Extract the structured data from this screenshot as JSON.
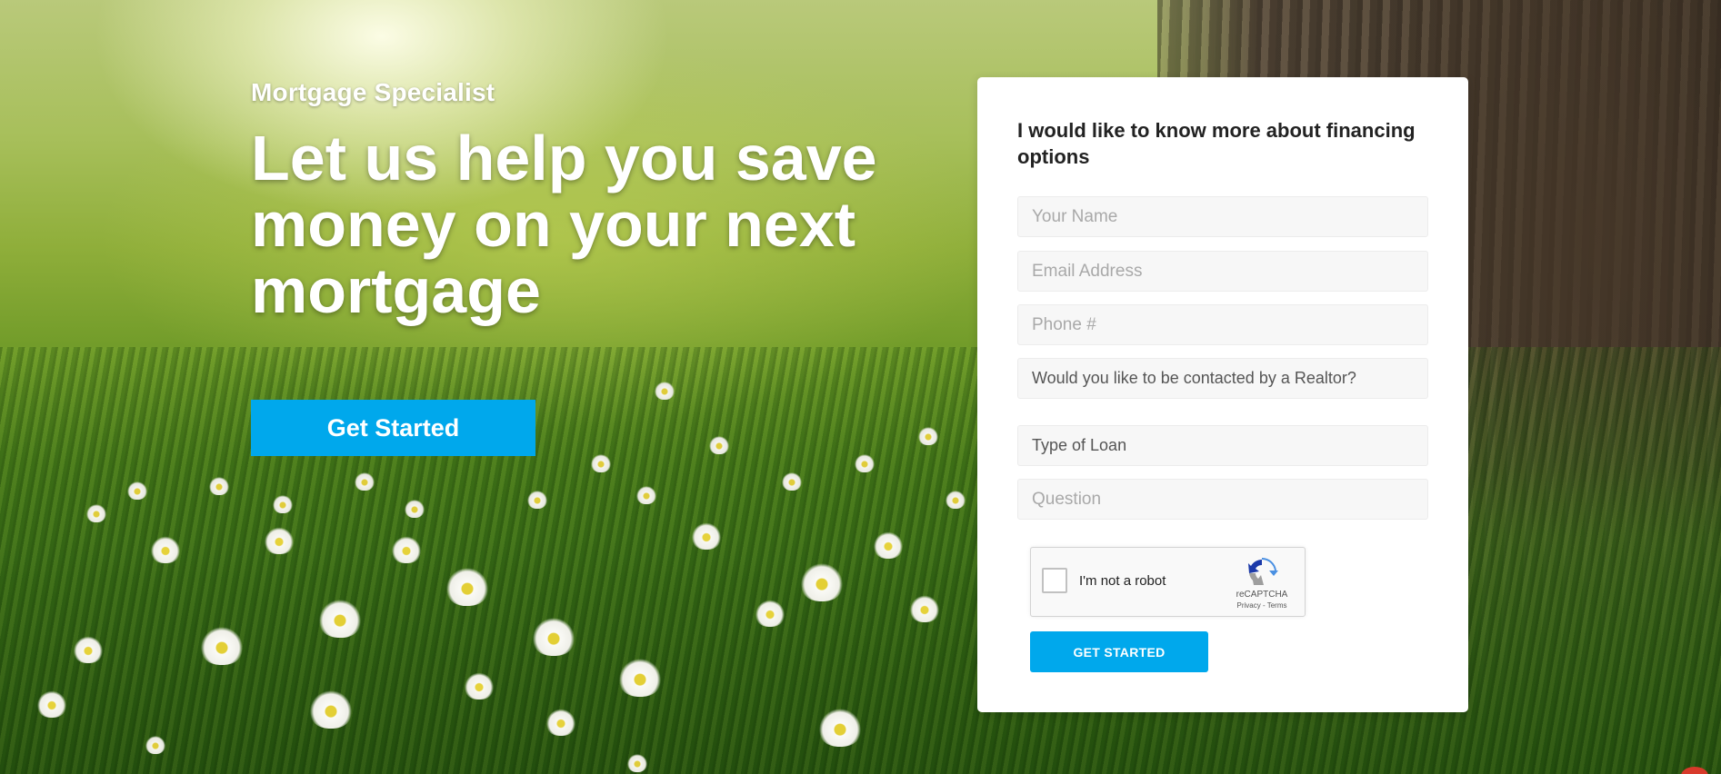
{
  "hero": {
    "kicker": "Mortgage Specialist",
    "headline": "Let us help you save money on your next mortgage",
    "cta_label": "Get Started"
  },
  "form": {
    "title": "I would like to know more about financing options",
    "fields": {
      "name_placeholder": "Your Name",
      "email_placeholder": "Email Address",
      "phone_placeholder": "Phone #",
      "realtor_select": "Would you like to be contacted by a Realtor?",
      "loan_select": "Type of Loan",
      "question_placeholder": "Question"
    },
    "recaptcha": {
      "label": "I'm not a robot",
      "brand": "reCAPTCHA",
      "links": "Privacy - Terms"
    },
    "submit_label": "GET STARTED"
  },
  "colors": {
    "accent": "#00a8ec",
    "card": "#ffffff"
  },
  "icons": {
    "recaptcha": "recaptcha-logo-icon"
  }
}
